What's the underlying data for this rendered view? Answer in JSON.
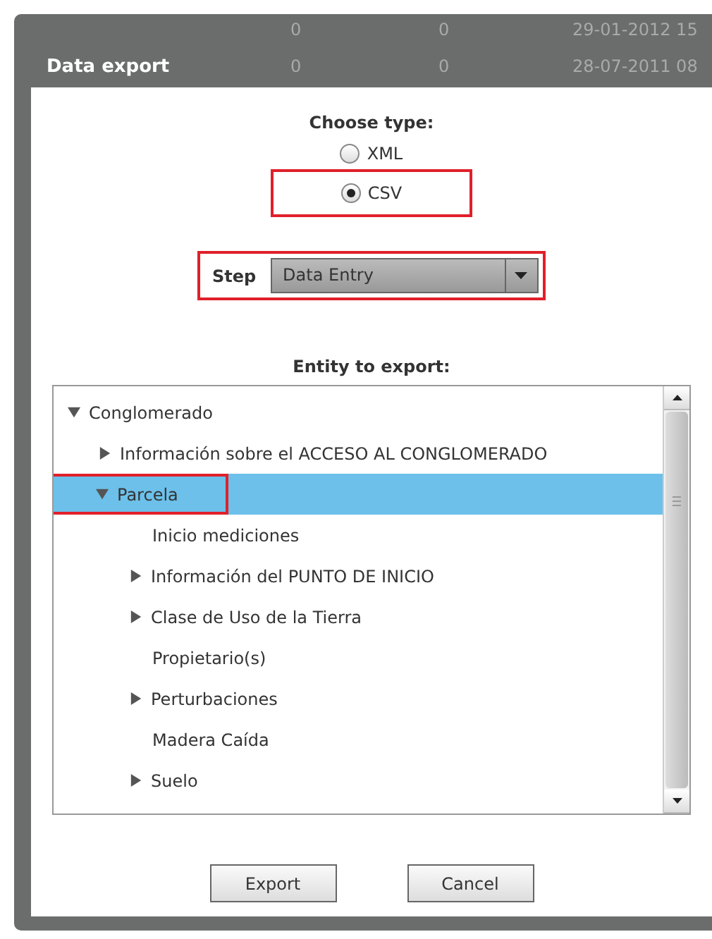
{
  "window": {
    "title": "Data export"
  },
  "background_rows": [
    [
      "0",
      "0",
      "29-01-2012 15"
    ],
    [
      "0",
      "0",
      "28-07-2011 08"
    ]
  ],
  "type_chooser": {
    "label": "Choose type:",
    "options": [
      {
        "label": "XML",
        "selected": false,
        "highlighted": false
      },
      {
        "label": "CSV",
        "selected": true,
        "highlighted": true
      }
    ]
  },
  "step": {
    "label": "Step",
    "value": "Data Entry",
    "highlighted": true
  },
  "entity": {
    "label": "Entity to export:",
    "tree": [
      {
        "label": "Conglomerado",
        "kind": "branch",
        "expanded": true,
        "selected": false,
        "highlighted": false,
        "children": [
          {
            "label": "Información sobre el ACCESO AL CONGLOMERADO",
            "kind": "branch",
            "expanded": false,
            "selected": false,
            "highlighted": false
          },
          {
            "label": "Parcela",
            "kind": "branch",
            "expanded": true,
            "selected": true,
            "highlighted": true,
            "children": [
              {
                "label": "Inicio mediciones",
                "kind": "leaf",
                "selected": false,
                "highlighted": false
              },
              {
                "label": "Información del PUNTO DE INICIO",
                "kind": "branch",
                "expanded": false,
                "selected": false,
                "highlighted": false
              },
              {
                "label": "Clase de Uso de la Tierra",
                "kind": "branch",
                "expanded": false,
                "selected": false,
                "highlighted": false
              },
              {
                "label": "Propietario(s)",
                "kind": "leaf",
                "selected": false,
                "highlighted": false
              },
              {
                "label": "Perturbaciones",
                "kind": "branch",
                "expanded": false,
                "selected": false,
                "highlighted": false
              },
              {
                "label": "Madera Caída",
                "kind": "leaf",
                "selected": false,
                "highlighted": false
              },
              {
                "label": "Suelo",
                "kind": "branch",
                "expanded": false,
                "selected": false,
                "highlighted": false
              }
            ]
          }
        ]
      }
    ]
  },
  "buttons": [
    "Export",
    "Cancel"
  ]
}
